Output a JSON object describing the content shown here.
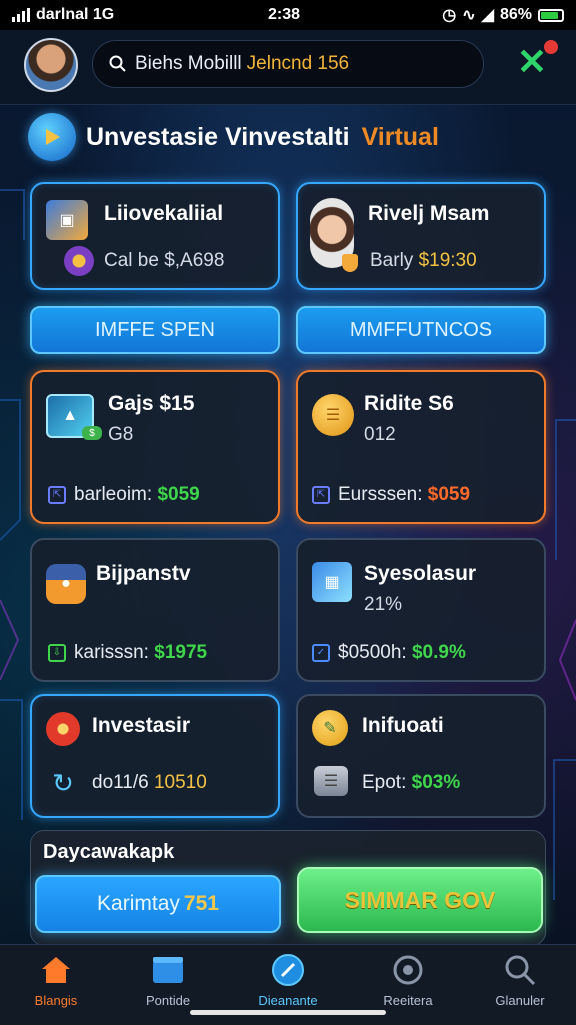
{
  "status_bar": {
    "carrier": "darlnal 1G",
    "time": "2:38",
    "battery": "86%",
    "battery_level": 0.86
  },
  "header": {
    "search_label": "Biehs Mobilll",
    "search_highlight": "Jelncnd 156",
    "close_icon": "close-icon",
    "notification_color": "#e53935"
  },
  "title": {
    "main": "Unvestasie Vinvestalti",
    "accent": "Virtual"
  },
  "top_cards": [
    {
      "title": "Liiovekaliial",
      "line": "Cal be $,A698"
    },
    {
      "title": "Rivelj Msam",
      "line_prefix": "Barly",
      "line_value": "$19:30"
    }
  ],
  "cta_buttons": [
    "IMFFE SPEN",
    "MMFFUTNCOS"
  ],
  "stat_cards": [
    {
      "title": "Gajs $15",
      "sub": "G8",
      "label": "barleoim:",
      "value": "$059"
    },
    {
      "title": "Ridite S6",
      "sub": "012",
      "label": "Eursssen:",
      "value": "$059"
    },
    {
      "title": "Bijpanstv",
      "sub": "",
      "label": "karisssn:",
      "value": "$1975"
    },
    {
      "title": "Syesolasur",
      "sub": "21%",
      "label": "$0500h:",
      "value": "$0.9%"
    },
    {
      "title": "Investasir",
      "sub": "",
      "label": "do11/6",
      "value": "10510"
    },
    {
      "title": "Inifuoati",
      "sub": "",
      "label": "Epot:",
      "value": "$03%"
    }
  ],
  "bottom_panel": {
    "title": "Daycawakapk",
    "left_button_label": "Karimtay",
    "left_button_value": "751",
    "right_button_label": "SIMMAR GOV"
  },
  "nav": [
    {
      "label": "Blangis",
      "icon": "home-icon"
    },
    {
      "label": "Pontide",
      "icon": "wallet-icon"
    },
    {
      "label": "Dieanante",
      "icon": "compass-icon"
    },
    {
      "label": "Reeitera",
      "icon": "settings-icon"
    },
    {
      "label": "Glanuler",
      "icon": "search-icon"
    }
  ],
  "colors": {
    "accent_blue": "#35a7ff",
    "accent_orange": "#f07a2a",
    "positive_green": "#3fd64b",
    "warning_orange": "#ff6a2a"
  }
}
